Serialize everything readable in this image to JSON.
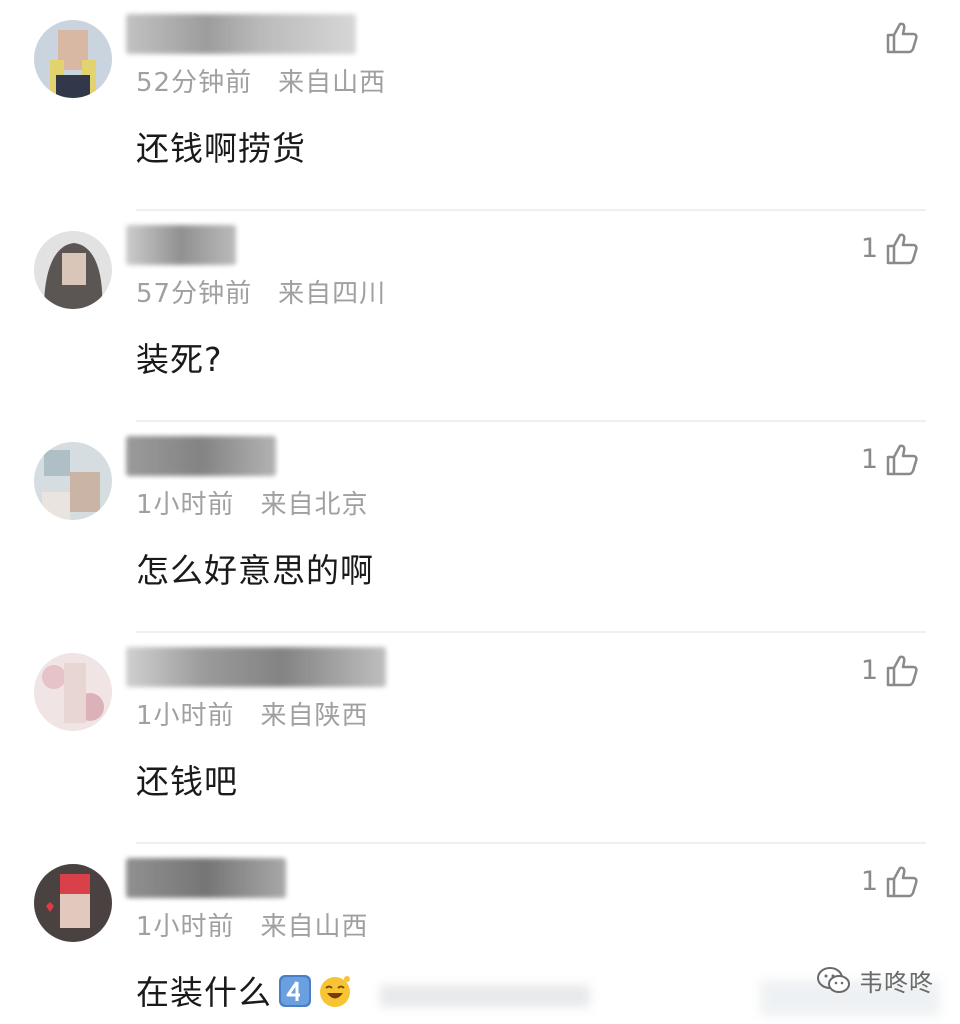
{
  "comments": [
    {
      "time": "52分钟前",
      "location": "来自山西",
      "text": "还钱啊捞货",
      "likes": ""
    },
    {
      "time": "57分钟前",
      "location": "来自四川",
      "text": "装死?",
      "likes": "1"
    },
    {
      "time": "1小时前",
      "location": "来自北京",
      "text": "怎么好意思的啊",
      "likes": "1"
    },
    {
      "time": "1小时前",
      "location": "来自陕西",
      "text": "还钱吧",
      "likes": "1"
    },
    {
      "time": "1小时前",
      "location": "来自山西",
      "text": "在装什么",
      "likes": "1"
    }
  ],
  "watermark": {
    "text": "韦咚咚"
  },
  "colors": {
    "meta": "#a0a0a0",
    "text": "#1a1a1a",
    "like": "#8a8a8a",
    "divider": "#f0f0f0"
  }
}
